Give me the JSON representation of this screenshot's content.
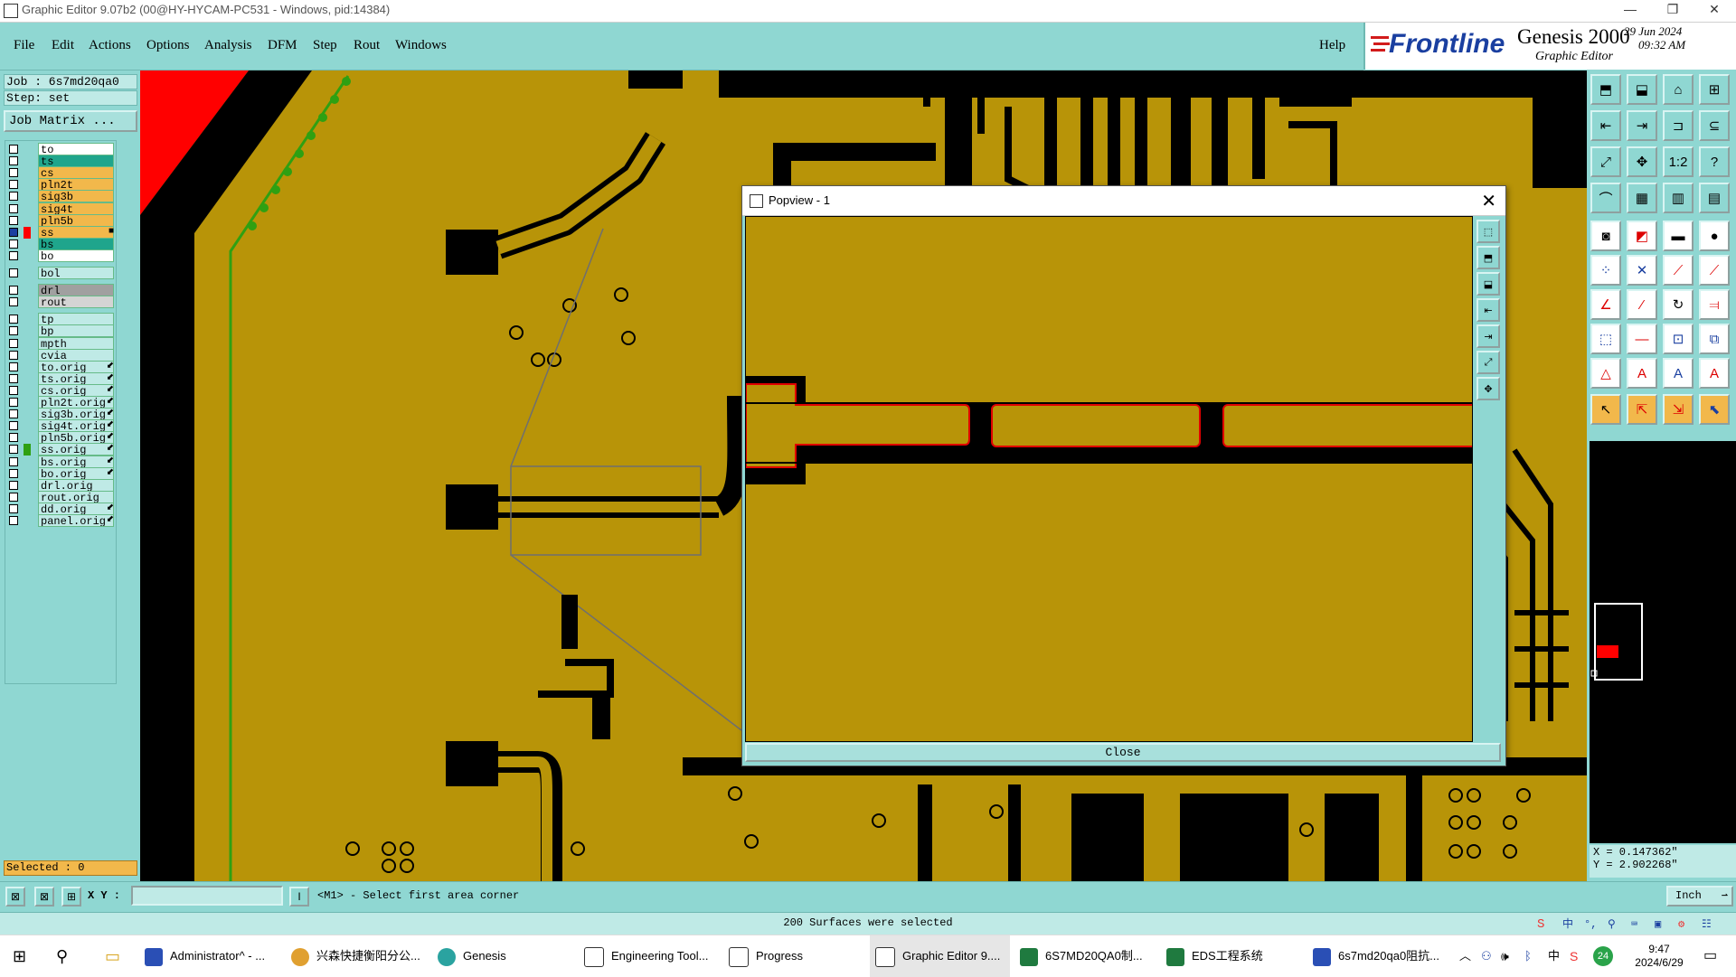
{
  "window": {
    "title": "Graphic Editor 9.07b2 (00@HY-HYCAM-PC531 - Windows, pid:14384)",
    "controls": [
      "—",
      "❐",
      "✕"
    ]
  },
  "menu": {
    "items": [
      "File",
      "Edit",
      "Actions",
      "Options",
      "Analysis",
      "DFM",
      "Step",
      "Rout",
      "Windows"
    ],
    "help": "Help"
  },
  "brand": {
    "logo": "Frontline",
    "product": "Genesis 2000",
    "subtitle": "Graphic Editor",
    "date": "29 Jun 2024",
    "time": "09:32 AM"
  },
  "job": {
    "job_line": "Job  : 6s7md20qa0",
    "step_line": "Step: set",
    "matrix_button": "Job Matrix ..."
  },
  "layers": [
    {
      "name": "to",
      "color": "#ffffff",
      "mark": ""
    },
    {
      "name": "ts",
      "color": "#1fa58c",
      "mark": ""
    },
    {
      "name": "cs",
      "color": "#f2b84b",
      "mark": ""
    },
    {
      "name": "pln2t",
      "color": "#f2b84b",
      "mark": ""
    },
    {
      "name": "sig3b",
      "color": "#f2b84b",
      "mark": ""
    },
    {
      "name": "sig4t",
      "color": "#f2b84b",
      "mark": ""
    },
    {
      "name": "pln5b",
      "color": "#f2b84b",
      "mark": ""
    },
    {
      "name": "ss",
      "color": "#f2b84b",
      "mark": "■",
      "active": true
    },
    {
      "name": "bs",
      "color": "#1fa58c",
      "mark": ""
    },
    {
      "name": "bo",
      "color": "#ffffff",
      "mark": ""
    },
    {
      "name": "bol",
      "color": "#bfeae6",
      "mark": ""
    },
    {
      "name": "drl",
      "color": "#a0a0a0",
      "mark": ""
    },
    {
      "name": "rout",
      "color": "#d4d4d4",
      "mark": ""
    },
    {
      "name": "tp",
      "color": "#bfeae6",
      "mark": ""
    },
    {
      "name": "bp",
      "color": "#bfeae6",
      "mark": ""
    },
    {
      "name": "mpth",
      "color": "#bfeae6",
      "mark": ""
    },
    {
      "name": "cvia",
      "color": "#bfeae6",
      "mark": ""
    },
    {
      "name": "to.orig",
      "color": "#bfeae6",
      "mark": "⬋"
    },
    {
      "name": "ts.orig",
      "color": "#bfeae6",
      "mark": "⬋"
    },
    {
      "name": "cs.orig",
      "color": "#bfeae6",
      "mark": "⬋"
    },
    {
      "name": "pln2t.orig",
      "color": "#bfeae6",
      "mark": "⬋"
    },
    {
      "name": "sig3b.orig",
      "color": "#bfeae6",
      "mark": "⬋"
    },
    {
      "name": "sig4t.orig",
      "color": "#bfeae6",
      "mark": "⬋"
    },
    {
      "name": "pln5b.orig",
      "color": "#bfeae6",
      "mark": "⬋"
    },
    {
      "name": "ss.orig",
      "color": "#bfeae6",
      "mark": "⬋",
      "swatch": "#2fa012"
    },
    {
      "name": "bs.orig",
      "color": "#bfeae6",
      "mark": "⬋"
    },
    {
      "name": "bo.orig",
      "color": "#bfeae6",
      "mark": "⬋"
    },
    {
      "name": "drl.orig",
      "color": "#bfeae6",
      "mark": ""
    },
    {
      "name": "rout.orig",
      "color": "#bfeae6",
      "mark": ""
    },
    {
      "name": "dd.orig",
      "color": "#bfeae6",
      "mark": "⬋"
    },
    {
      "name": "panel.orig",
      "color": "#bfeae6",
      "mark": "⬋"
    }
  ],
  "selected_label": "Selected : 0",
  "coords": {
    "x": "X  =  0.147362\"",
    "y": "Y  =  2.902268\""
  },
  "command": {
    "xy_label": "X Y :",
    "xy_value": "",
    "prompt": "<M1> - Select first area corner",
    "units": "Inch"
  },
  "status": "200 Surfaces were selected",
  "popview": {
    "title": "Popview - 1",
    "close_label": "Close"
  },
  "colors": {
    "board": "#b89408",
    "copper_outline": "#e00000",
    "ui_teal": "#8fd7d2"
  },
  "taskbar": {
    "apps": [
      {
        "label": "Administrator^ - ...",
        "icon": "notepad-icon"
      },
      {
        "label": "兴森快捷衡阳分公...",
        "icon": "browser-icon"
      },
      {
        "label": "Genesis",
        "icon": "genesis-icon"
      },
      {
        "label": "Engineering Tool...",
        "icon": "tool-icon"
      },
      {
        "label": "Progress",
        "icon": "progress-icon"
      },
      {
        "label": "Graphic Editor 9....",
        "icon": "editor-icon"
      },
      {
        "label": "6S7MD20QA0制...",
        "icon": "excel-icon"
      },
      {
        "label": "EDS工程系统",
        "icon": "eds-icon"
      },
      {
        "label": "6s7md20qa0阻抗...",
        "icon": "doc-icon"
      }
    ],
    "ime": "中",
    "badge": "24",
    "time": "9:47",
    "date": "2024/6/29"
  }
}
